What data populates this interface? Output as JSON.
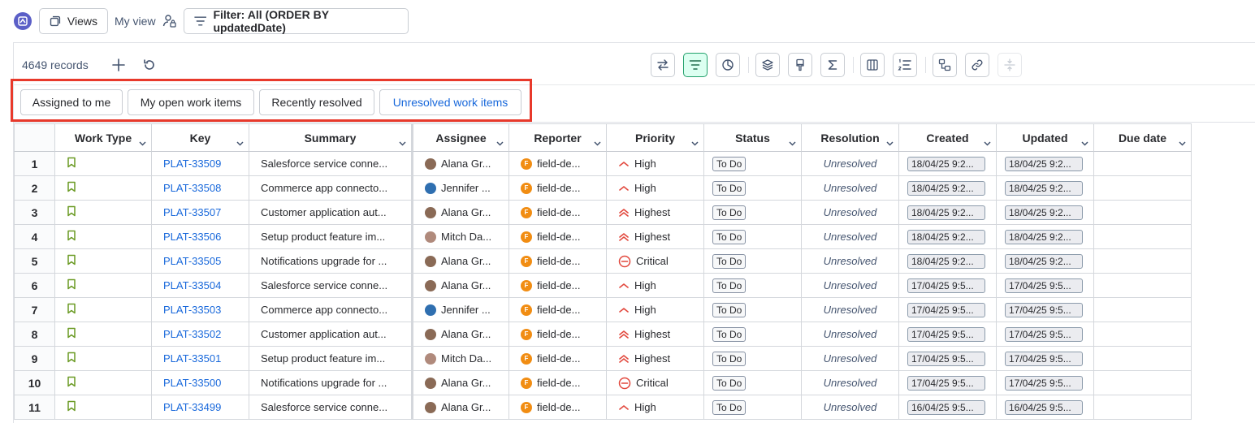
{
  "topbar": {
    "views_label": "Views",
    "my_view_label": "My view",
    "filter_label": "Filter: All (ORDER BY updatedDate)"
  },
  "toolbar": {
    "records_label": "4649 records",
    "tools": [
      "swap-icon",
      "filter-lines-icon",
      "pie-chart-icon",
      "layers-icon",
      "paint-brush-icon",
      "sigma-icon",
      "columns-icon",
      "numbered-list-icon",
      "hierarchy-icon",
      "link-icon",
      "collapse-icon"
    ]
  },
  "quick_filters": [
    {
      "label": "Assigned to me",
      "selected": false
    },
    {
      "label": "My open work items",
      "selected": false
    },
    {
      "label": "Recently resolved",
      "selected": false
    },
    {
      "label": "Unresolved work items",
      "selected": true
    }
  ],
  "columns": [
    "",
    "Work Type",
    "Key",
    "Summary",
    "Assignee",
    "Reporter",
    "Priority",
    "Status",
    "Resolution",
    "Created",
    "Updated",
    "Due date"
  ],
  "rows": [
    {
      "n": "1",
      "key": "PLAT-33509",
      "summary": "Salesforce service conne...",
      "assignee": "Alana Gr...",
      "reporter": "field-de...",
      "priority": "High",
      "status": "To Do",
      "resolution": "Unresolved",
      "created": "18/04/25 9:2...",
      "updated": "18/04/25 9:2...",
      "due": ""
    },
    {
      "n": "2",
      "key": "PLAT-33508",
      "summary": "Commerce app connecto...",
      "assignee": "Jennifer ...",
      "reporter": "field-de...",
      "priority": "High",
      "status": "To Do",
      "resolution": "Unresolved",
      "created": "18/04/25 9:2...",
      "updated": "18/04/25 9:2...",
      "due": ""
    },
    {
      "n": "3",
      "key": "PLAT-33507",
      "summary": "Customer application aut...",
      "assignee": "Alana Gr...",
      "reporter": "field-de...",
      "priority": "Highest",
      "status": "To Do",
      "resolution": "Unresolved",
      "created": "18/04/25 9:2...",
      "updated": "18/04/25 9:2...",
      "due": ""
    },
    {
      "n": "4",
      "key": "PLAT-33506",
      "summary": "Setup product feature im...",
      "assignee": "Mitch Da...",
      "reporter": "field-de...",
      "priority": "Highest",
      "status": "To Do",
      "resolution": "Unresolved",
      "created": "18/04/25 9:2...",
      "updated": "18/04/25 9:2...",
      "due": ""
    },
    {
      "n": "5",
      "key": "PLAT-33505",
      "summary": "Notifications upgrade for ...",
      "assignee": "Alana Gr...",
      "reporter": "field-de...",
      "priority": "Critical",
      "status": "To Do",
      "resolution": "Unresolved",
      "created": "18/04/25 9:2...",
      "updated": "18/04/25 9:2...",
      "due": ""
    },
    {
      "n": "6",
      "key": "PLAT-33504",
      "summary": "Salesforce service conne...",
      "assignee": "Alana Gr...",
      "reporter": "field-de...",
      "priority": "High",
      "status": "To Do",
      "resolution": "Unresolved",
      "created": "17/04/25 9:5...",
      "updated": "17/04/25 9:5...",
      "due": ""
    },
    {
      "n": "7",
      "key": "PLAT-33503",
      "summary": "Commerce app connecto...",
      "assignee": "Jennifer ...",
      "reporter": "field-de...",
      "priority": "High",
      "status": "To Do",
      "resolution": "Unresolved",
      "created": "17/04/25 9:5...",
      "updated": "17/04/25 9:5...",
      "due": ""
    },
    {
      "n": "8",
      "key": "PLAT-33502",
      "summary": "Customer application aut...",
      "assignee": "Alana Gr...",
      "reporter": "field-de...",
      "priority": "Highest",
      "status": "To Do",
      "resolution": "Unresolved",
      "created": "17/04/25 9:5...",
      "updated": "17/04/25 9:5...",
      "due": ""
    },
    {
      "n": "9",
      "key": "PLAT-33501",
      "summary": "Setup product feature im...",
      "assignee": "Mitch Da...",
      "reporter": "field-de...",
      "priority": "Highest",
      "status": "To Do",
      "resolution": "Unresolved",
      "created": "17/04/25 9:5...",
      "updated": "17/04/25 9:5...",
      "due": ""
    },
    {
      "n": "10",
      "key": "PLAT-33500",
      "summary": "Notifications upgrade for ...",
      "assignee": "Alana Gr...",
      "reporter": "field-de...",
      "priority": "Critical",
      "status": "To Do",
      "resolution": "Unresolved",
      "created": "17/04/25 9:5...",
      "updated": "17/04/25 9:5...",
      "due": ""
    },
    {
      "n": "11",
      "key": "PLAT-33499",
      "summary": "Salesforce service conne...",
      "assignee": "Alana Gr...",
      "reporter": "field-de...",
      "priority": "High",
      "status": "To Do",
      "resolution": "Unresolved",
      "created": "16/04/25 9:5...",
      "updated": "16/04/25 9:5...",
      "due": ""
    }
  ],
  "reporter_initial": "F",
  "colors": {
    "accent": "#1868db",
    "highlight_frame": "#e8392b",
    "priority_red": "#e2483d",
    "work_type_green": "#6a9a23",
    "reporter_orange": "#f18d13"
  }
}
